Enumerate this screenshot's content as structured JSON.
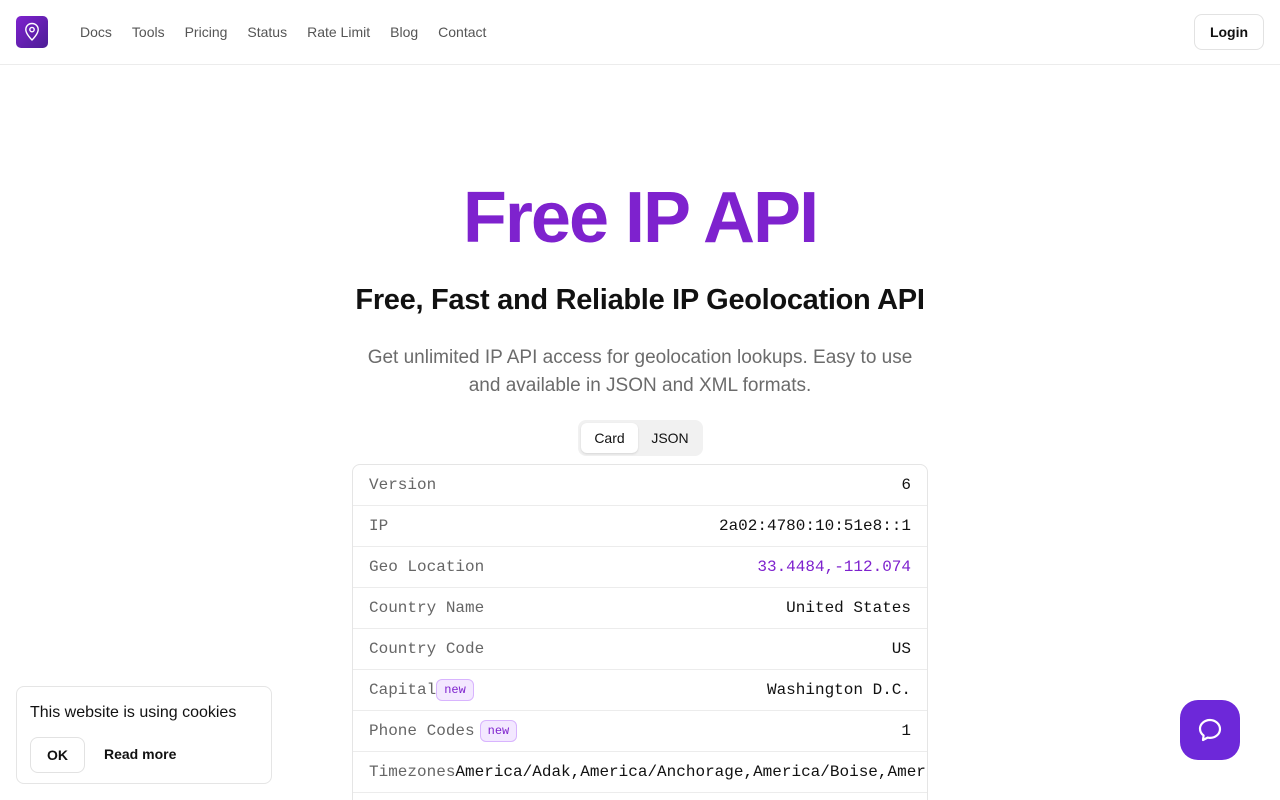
{
  "header": {
    "nav": [
      "Docs",
      "Tools",
      "Pricing",
      "Status",
      "Rate Limit",
      "Blog",
      "Contact"
    ],
    "login_label": "Login"
  },
  "hero": {
    "title": "Free IP API",
    "subtitle": "Free, Fast and Reliable IP Geolocation API",
    "description": "Get unlimited IP API access for geolocation lookups. Easy to use and available in JSON and XML formats."
  },
  "toggle": {
    "card": "Card",
    "json": "JSON",
    "active": "Card"
  },
  "card": {
    "badge": "new",
    "rows": [
      {
        "label": "Version",
        "value": "6"
      },
      {
        "label": "IP",
        "value": "2a02:4780:10:51e8::1"
      },
      {
        "label": "Geo Location",
        "value": "33.4484,-112.074"
      },
      {
        "label": "Country Name",
        "value": "United States"
      },
      {
        "label": "Country Code",
        "value": "US"
      },
      {
        "label": "Capital",
        "value": "Washington D.C."
      },
      {
        "label": "Phone Codes",
        "value": "1"
      },
      {
        "label": "Timezones",
        "value": "America/Adak,America/Anchorage,America/Boise,America/Chicago,America/Denver,America/De"
      }
    ]
  },
  "cookie": {
    "text": "This website is using cookies",
    "ok_label": "OK",
    "read_more_label": "Read more"
  },
  "colors": {
    "accent": "#7e22ce",
    "chat_button": "#6d28d9"
  },
  "icons": {
    "logo": "location-pin-icon",
    "chat": "chat-bubble-icon"
  }
}
